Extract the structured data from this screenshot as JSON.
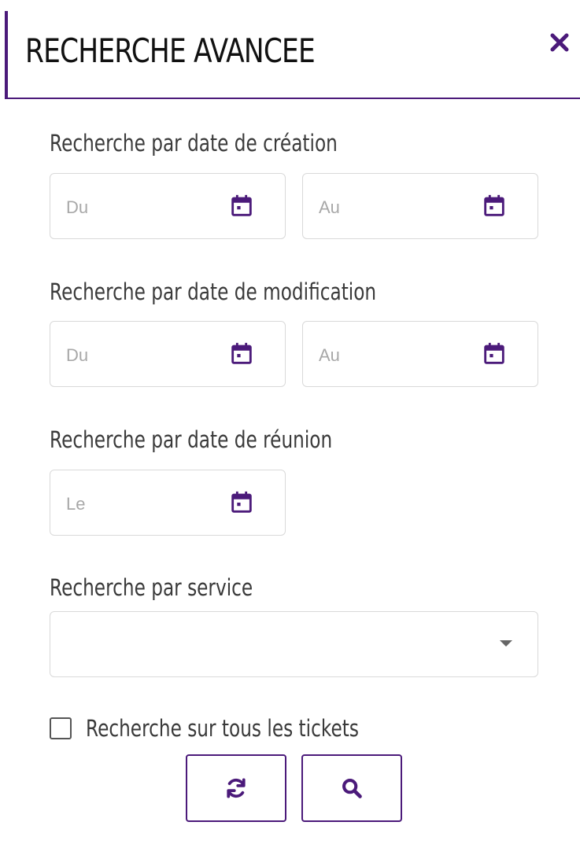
{
  "panel": {
    "title": "RECHERCHE AVANCEE"
  },
  "colors": {
    "accent": "#4b1a7a",
    "border": "#d9d9d9",
    "placeholder": "#a8a8a8"
  },
  "icons": {
    "close": "close-icon",
    "calendar": "calendar-icon",
    "dropdown": "caret-down-icon",
    "reset": "refresh-icon",
    "search": "search-icon"
  },
  "creation": {
    "label": "Recherche par date de création",
    "from_placeholder": "Du",
    "to_placeholder": "Au",
    "from_value": "",
    "to_value": ""
  },
  "modification": {
    "label": "Recherche par date de modification",
    "from_placeholder": "Du",
    "to_placeholder": "Au",
    "from_value": "",
    "to_value": ""
  },
  "meeting": {
    "label": "Recherche par date de réunion",
    "on_placeholder": "Le",
    "on_value": ""
  },
  "service": {
    "label": "Recherche par service",
    "selected": ""
  },
  "all_tickets": {
    "label": "Recherche sur tous les tickets",
    "checked": false
  }
}
